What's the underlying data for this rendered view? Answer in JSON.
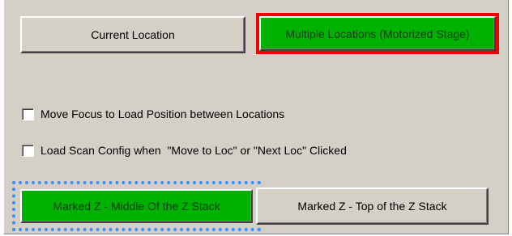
{
  "buttons": {
    "current_location": "Current Location",
    "multiple_locations": "Multiple Locations (Motorized Stage)",
    "marked_z_middle": "Marked Z - Middle Of the Z Stack",
    "marked_z_top": "Marked Z - Top of the Z Stack"
  },
  "options": {
    "move_focus_label": "Move Focus to Load Position between Locations",
    "move_focus_checked": false,
    "load_scan_label": "Load Scan Config when  \"Move to Loc\" or \"Next Loc\" Clicked",
    "load_scan_checked": false
  },
  "colors": {
    "selected_fill": "#00b200",
    "highlight_outline": "#ee0000",
    "focus_outline": "#3a8fff",
    "panel": "#d4d0c8"
  }
}
